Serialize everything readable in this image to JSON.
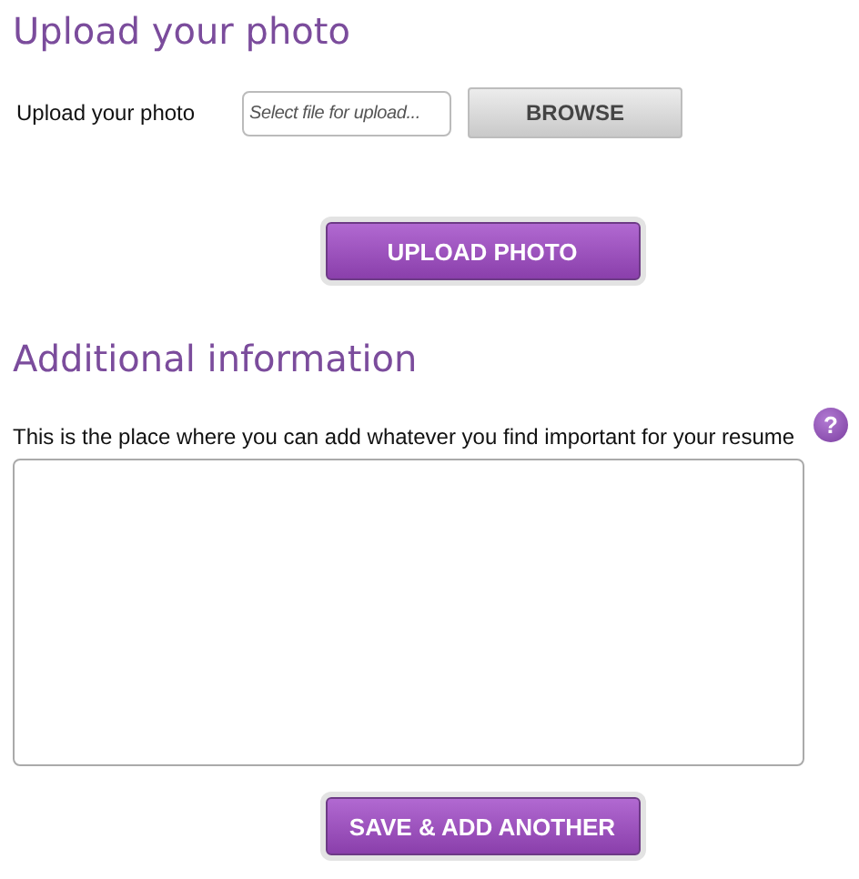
{
  "upload_section": {
    "heading": "Upload your photo",
    "field_label": "Upload your photo",
    "file_field": {
      "placeholder": "Select file for upload..."
    },
    "browse_button": "BROWSE",
    "upload_button": "UPLOAD PHOTO"
  },
  "additional_section": {
    "heading": "Additional information",
    "description": "This is the place where you can add whatever you find important for your resume",
    "help_glyph": "?",
    "save_button": "SAVE & ADD ANOTHER"
  }
}
